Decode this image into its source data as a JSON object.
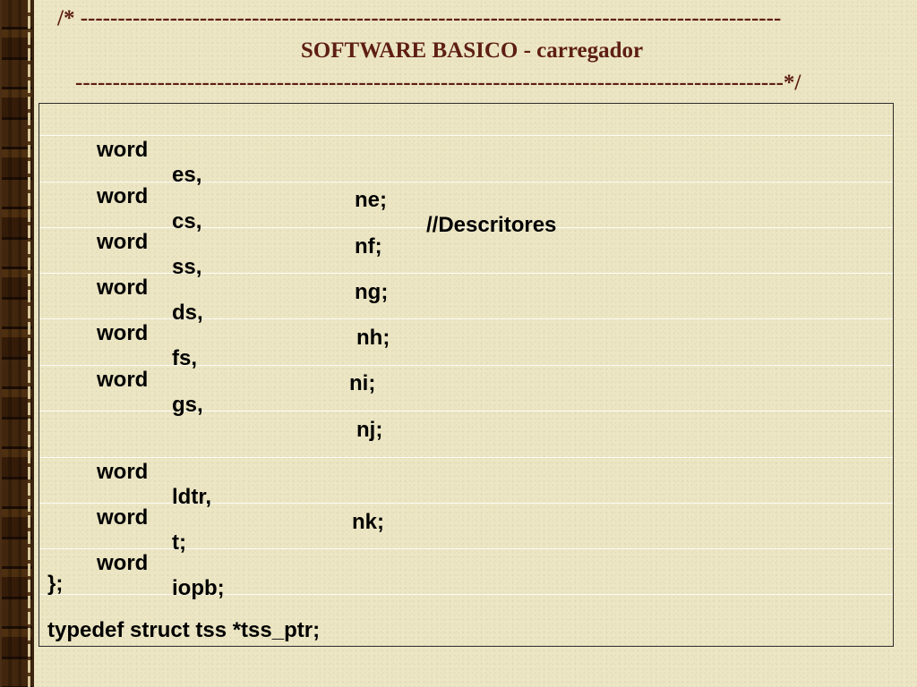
{
  "slide": {
    "title_line1": "/* ----------------------------------------------------------------------------------------------",
    "title_line2": "SOFTWARE BASICO - carregador",
    "title_line3": "-----------------------------------------------------------------------------------------------*/"
  },
  "code": {
    "rows": [
      {
        "type": "word",
        "name": "es,",
        "field2": "ne;",
        "comment": "//Descritores"
      },
      {
        "type": "word",
        "name": "cs,",
        "field2": "nf;"
      },
      {
        "type": "word",
        "name": "ss,",
        "field2": "ng;"
      },
      {
        "type": "word",
        "name": "ds,",
        "field2": "nh;"
      },
      {
        "type": "word",
        "name": "fs,",
        "field2": "ni;"
      },
      {
        "type": "word",
        "name": "gs,",
        "field2": "nj;"
      },
      {
        "type": "word",
        "name": "ldtr,",
        "field2": "nk;"
      },
      {
        "type": "word",
        "name": "t;"
      },
      {
        "type": "word",
        "name": "iopb;"
      }
    ],
    "closing": "};",
    "typedef": "typedef struct tss *tss_ptr;"
  }
}
